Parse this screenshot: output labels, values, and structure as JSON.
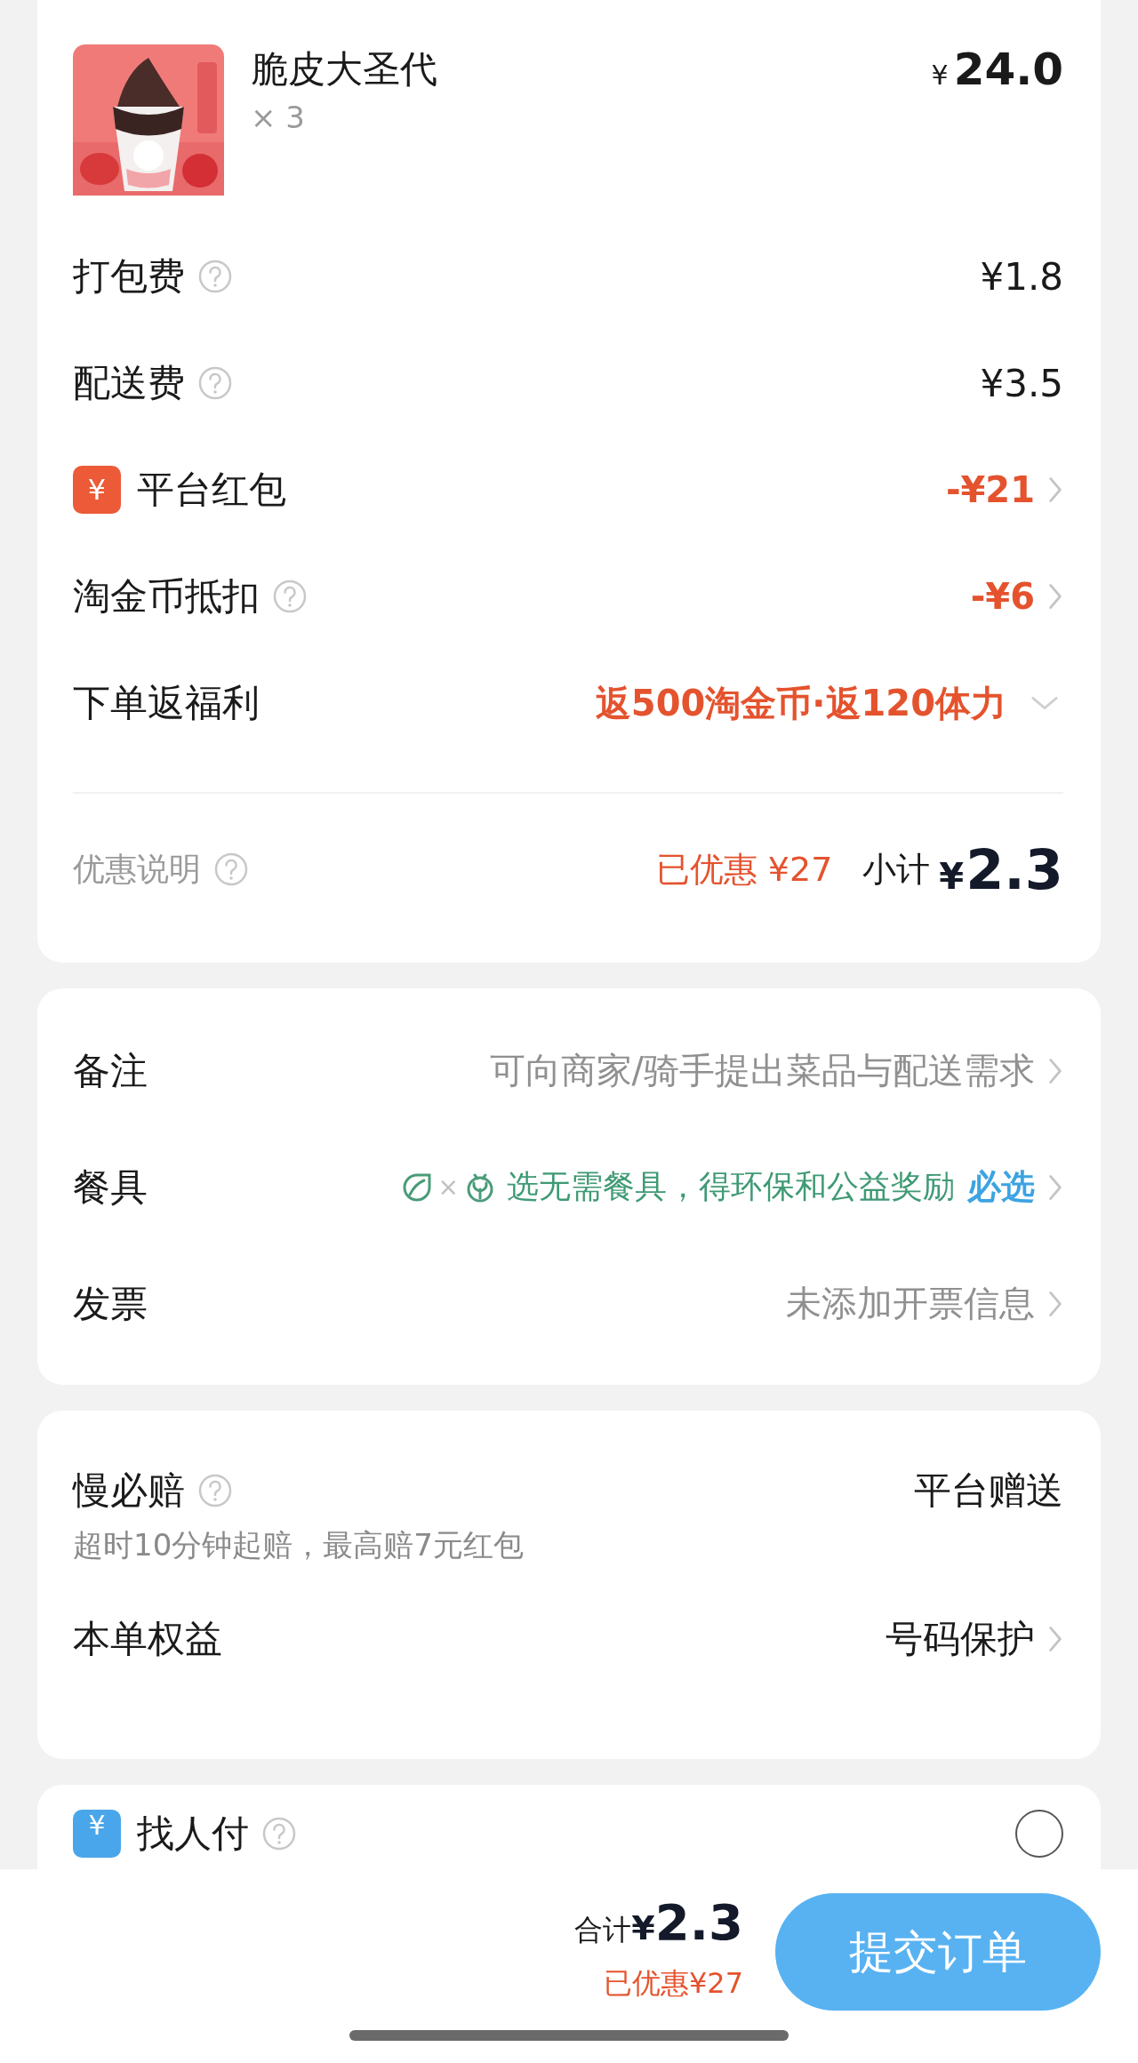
{
  "order_items": [
    {
      "kind": "picture",
      "name": "脆皮大圣代",
      "quantity": "× 3",
      "currency": "¥",
      "price": "24.0"
    }
  ],
  "charges": [
    {
      "kind": "fee",
      "label": "打包费",
      "help": true,
      "value": "¥1.8"
    },
    {
      "kind": "fee",
      "label": "配送费",
      "help": true,
      "value": "¥3.5"
    },
    {
      "kind": "coupon",
      "icon_glyph": "¥",
      "label": "平台红包",
      "help": false,
      "value": "-¥21"
    },
    {
      "kind": "discount",
      "label": "淘金币抵扣",
      "help": true,
      "value": "-¥6"
    },
    {
      "kind": "welfare",
      "label": "下单返福利",
      "help": false,
      "value": "返500淘金币·返120体力",
      "expanded": false
    }
  ],
  "summary": {
    "label": "优惠说明",
    "help": true,
    "saved": "已优惠 ¥27",
    "subtotal_label": "小计",
    "subtotal_currency": "¥",
    "subtotal": "2.3"
  },
  "options": [
    {
      "kind": "text",
      "label": "备注",
      "value": "可向商家/骑手提出菜品与配送需求"
    },
    {
      "kind": "tableware",
      "label": "餐具",
      "icon_separator": "×",
      "value": "选无需餐具，得环保和公益奖励",
      "badge": "必选"
    },
    {
      "kind": "text",
      "label": "发票",
      "value": "未添加开票信息"
    }
  ],
  "guarantee": {
    "label": "慢必赔",
    "help": true,
    "value": "平台赠送",
    "note": "超时10分钟起赔，最高赔7元红包"
  },
  "benefits": {
    "label": "本单权益",
    "value": "号码保护"
  },
  "pay_for_me": {
    "icon_glyph": "¥",
    "label": "找人付",
    "help": true,
    "selected": false
  },
  "footer": {
    "total_label": "合计",
    "total_currency": "¥",
    "total": "2.3",
    "saved": "已优惠¥27",
    "submit": "提交订单"
  }
}
